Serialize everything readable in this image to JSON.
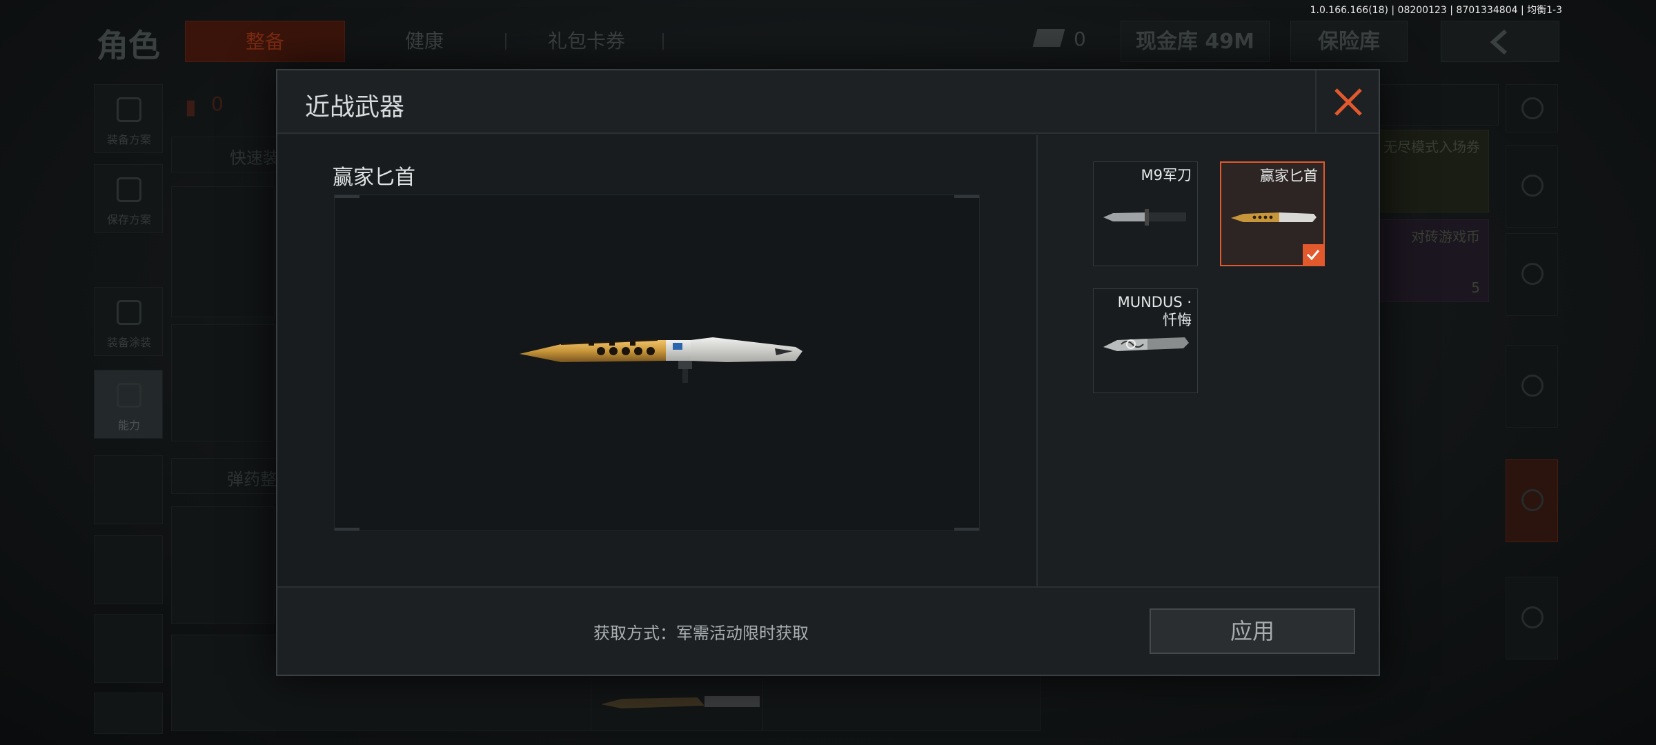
{
  "version_info": "1.0.166.166(18) | 08200123 | 8701334804 | 均衡1-3",
  "background": {
    "title": "角色",
    "tabs": [
      {
        "label": "整备",
        "active": true
      },
      {
        "label": "健康",
        "active": false
      },
      {
        "label": "礼包卡券",
        "active": false
      }
    ],
    "cash_count": "0",
    "cash_vault": "现金库 49M",
    "safe": "保险库",
    "sidebar": [
      {
        "label": "装备方案",
        "icon": "vest-icon"
      },
      {
        "label": "保存方案",
        "icon": "download-icon"
      },
      {
        "label": "装备涂装",
        "icon": "helmet-icon"
      },
      {
        "label": "能力",
        "icon": "lightning-icon",
        "active": true
      }
    ],
    "counter": "0",
    "quick_equip": "快速装",
    "ammo": "弹药整",
    "shop_cards": [
      {
        "label": "无尽模式入场券"
      },
      {
        "label": "对砖游戏币",
        "count": "5"
      }
    ]
  },
  "modal": {
    "title": "近战武器",
    "selected_weapon_name": "赢家匕首",
    "acquire_text": "获取方式：军需活动限时获取",
    "apply_label": "应用",
    "items": [
      {
        "label": "M9军刀",
        "selected": false
      },
      {
        "label": "赢家匕首",
        "selected": true
      },
      {
        "label": "MUNDUS · 忏悔",
        "selected": false
      }
    ]
  },
  "colors": {
    "accent": "#e2592e",
    "modal_bg": "#1a1e20",
    "blade_gold": "#c8963a"
  }
}
